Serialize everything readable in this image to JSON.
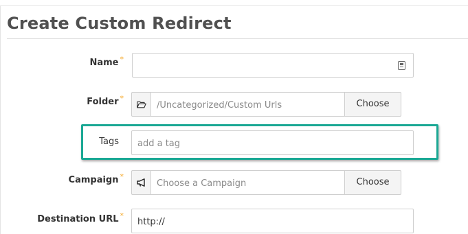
{
  "page": {
    "title": "Create Custom Redirect"
  },
  "form": {
    "required_mark": "*",
    "name": {
      "label": "Name",
      "value": ""
    },
    "folder": {
      "label": "Folder",
      "value": "/Uncategorized/Custom Urls",
      "button": "Choose",
      "icon": "folder-icon"
    },
    "tags": {
      "label": "Tags",
      "placeholder": "add a tag"
    },
    "campaign": {
      "label": "Campaign",
      "placeholder": "Choose a Campaign",
      "button": "Choose",
      "icon": "megaphone-icon"
    },
    "destination": {
      "label": "Destination URL",
      "value": "http://"
    }
  },
  "colors": {
    "highlight": "#1aa894",
    "required": "#f5a623"
  }
}
